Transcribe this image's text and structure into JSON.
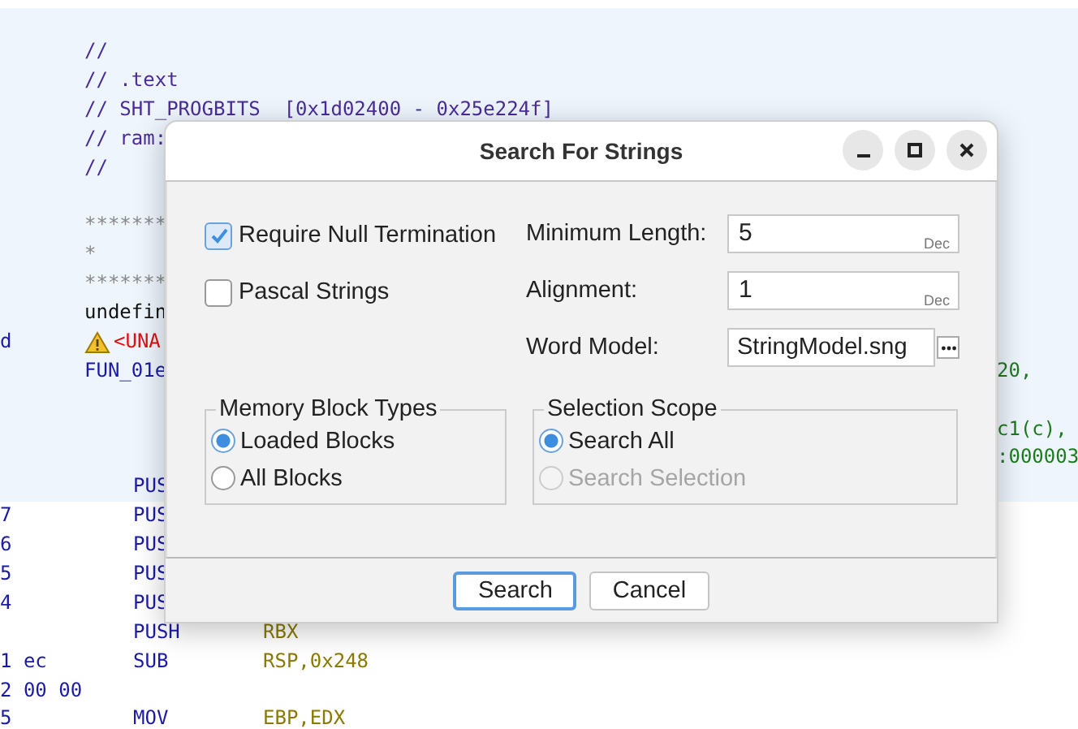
{
  "listing": {
    "lines": [
      {
        "kind": "comment",
        "text": "//",
        "highlighted": true
      },
      {
        "kind": "comment",
        "text": "// .text",
        "highlighted": true
      },
      {
        "kind": "comment",
        "text": "// SHT_PROGBITS  [0x1d02400 - 0x25e224f]",
        "highlighted": true
      },
      {
        "kind": "comment",
        "text": "// ram:",
        "highlighted": true
      },
      {
        "kind": "comment",
        "text": "//",
        "highlighted": true
      },
      {
        "kind": "blank",
        "highlighted": true
      },
      {
        "kind": "stars",
        "text": "*******",
        "highlighted": true
      },
      {
        "kind": "stars",
        "text": "*",
        "highlighted": true
      },
      {
        "kind": "stars",
        "text": "*******",
        "highlighted": true
      },
      {
        "kind": "label",
        "text": "undefin",
        "highlighted": true
      },
      {
        "kind": "warning",
        "bytes": "d",
        "text": "<UNA",
        "highlighted": true
      },
      {
        "kind": "function",
        "text": "FUN_01e",
        "trailing": "20,",
        "highlighted": true
      },
      {
        "kind": "blank",
        "highlighted": true
      },
      {
        "kind": "blank",
        "trailing": "c1(c),",
        "highlighted": true
      },
      {
        "kind": "blank",
        "trailing": ":000003",
        "highlighted": true
      },
      {
        "kind": "instruction",
        "text": "PUS",
        "highlighted": true
      },
      {
        "kind": "instruction",
        "bytes": "7",
        "text": "PUS",
        "highlighted": false
      },
      {
        "kind": "instruction",
        "bytes": "6",
        "text": "PUS",
        "highlighted": false
      },
      {
        "kind": "instruction",
        "bytes": "5",
        "text": "PUS",
        "highlighted": false
      },
      {
        "kind": "instruction",
        "bytes": "4",
        "text": "PUS",
        "highlighted": false
      },
      {
        "kind": "instruction",
        "text": "PUSH",
        "operands": "RBX",
        "highlighted": false
      },
      {
        "kind": "instruction",
        "bytes": "1 ec",
        "text": "SUB",
        "operands": "RSP,0x248",
        "highlighted": false
      },
      {
        "kind": "instruction",
        "bytes": "2 00 00",
        "highlighted": false
      },
      {
        "kind": "instruction",
        "bytes": "5",
        "text": "MOV",
        "operands": "EBP,EDX",
        "highlighted": false
      }
    ]
  },
  "dialog": {
    "title": "Search For Strings",
    "options": [
      {
        "label": "Require Null Termination",
        "checked": true
      },
      {
        "label": "Pascal Strings",
        "checked": false
      }
    ],
    "fields": [
      {
        "kind": "number",
        "label": "Minimum Length:",
        "value": "5",
        "unit": "Dec"
      },
      {
        "kind": "number",
        "label": "Alignment:",
        "value": "1",
        "unit": "Dec"
      },
      {
        "kind": "file",
        "label": "Word Model:",
        "value": "StringModel.sng"
      }
    ],
    "groups": [
      {
        "title": "Memory Block Types",
        "choices": [
          {
            "label": "Loaded Blocks",
            "selected": true,
            "disabled": false
          },
          {
            "label": "All Blocks",
            "selected": false,
            "disabled": false
          }
        ]
      },
      {
        "title": "Selection Scope",
        "choices": [
          {
            "label": "Search All",
            "selected": true,
            "disabled": false
          },
          {
            "label": "Search Selection",
            "selected": false,
            "disabled": true
          }
        ]
      }
    ],
    "buttons": [
      {
        "label": "Search",
        "focused": true
      },
      {
        "label": "Cancel",
        "focused": false
      }
    ]
  }
}
